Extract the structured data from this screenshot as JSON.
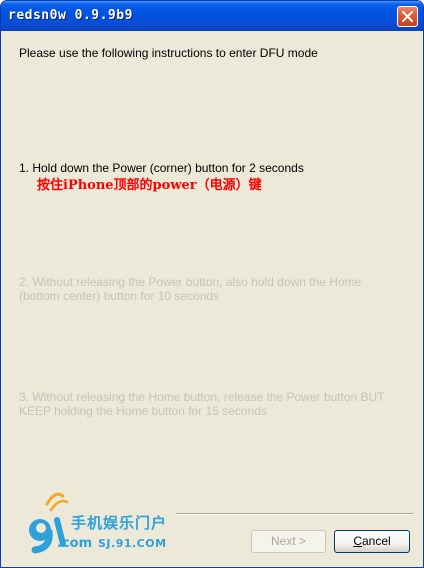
{
  "window": {
    "title": "redsn0w 0.9.9b9"
  },
  "instructions": {
    "intro": "Please use the following instructions to enter DFU mode",
    "step1": "1. Hold down the Power (corner) button for 2 seconds",
    "step1_annotation": "按住iPhone顶部的power（电源）键",
    "step2": "2. Without releasing the Power button, also hold down the Home (bottom center) button for 10 seconds",
    "step3": "3. Without releasing the Home button, release the Power button BUT KEEP holding the Home button for 15 seconds"
  },
  "buttons": {
    "next": "Next >",
    "next_enabled": false,
    "cancel_prefix": "",
    "cancel_underlined": "C",
    "cancel_rest": "ancel"
  },
  "watermark": {
    "brand_cn": "手机娱乐门户",
    "brand_com": ".com",
    "url": "SJ.91.COM"
  },
  "colors": {
    "titlebar": "#0054e3",
    "dialog_bg": "#ece9d8",
    "annotation": "#ff0000",
    "disabled_text": "#c6c3b5",
    "watermark": "#2ea0dc"
  }
}
